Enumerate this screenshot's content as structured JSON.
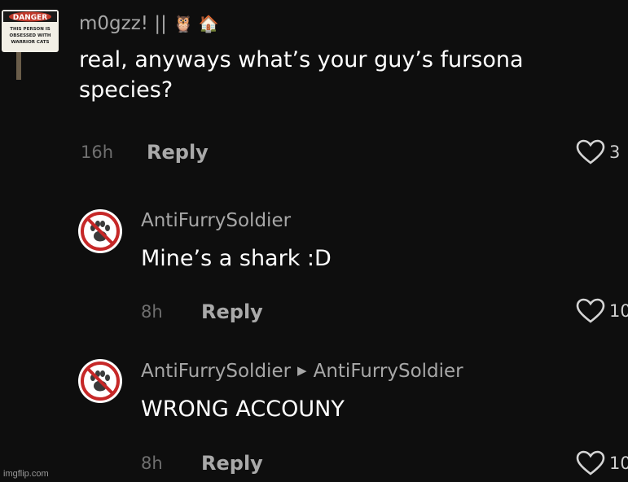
{
  "comments": [
    {
      "username": "m0gzz! ||",
      "badge_icons": [
        "owl-emoji",
        "house-emoji"
      ],
      "avatar_text": {
        "top": "DANGER",
        "body": "THIS PERSON IS OBSESSED WITH WARRIOR CATS"
      },
      "text_line1": "real, anyways what’s your guy’s fursona",
      "text_line2": "species?",
      "time": "16h",
      "reply_label": "Reply",
      "likes": "3"
    },
    {
      "username": "AntiFurrySoldier",
      "text": "Mine’s a shark :D",
      "time": "8h",
      "reply_label": "Reply",
      "likes": "10"
    },
    {
      "username": "AntiFurrySoldier",
      "reply_to": "AntiFurrySoldier",
      "text": "WRONG ACCOUNY",
      "time": "8h",
      "reply_label": "Reply",
      "likes": "10"
    }
  ],
  "watermark": "imgflip.com",
  "colors": {
    "background": "#0e0e0e",
    "username": "#a7a7a7",
    "meta": "#6f6f6f",
    "danger_red": "#c0392b"
  }
}
